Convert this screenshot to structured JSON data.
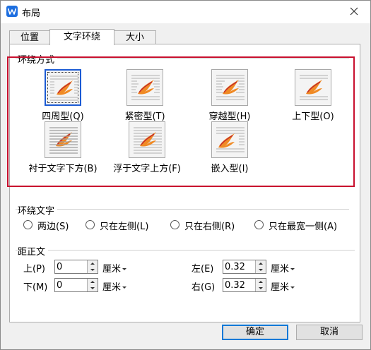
{
  "window": {
    "title": "布局",
    "icon": "wps-w-logo",
    "close_icon": "close-icon"
  },
  "tabs": [
    {
      "label": "位置",
      "active": false
    },
    {
      "label": "文字环绕",
      "active": true
    },
    {
      "label": "大小",
      "active": false
    }
  ],
  "wrap_style": {
    "group_label": "环绕方式",
    "selected": "四周型(Q)",
    "items": [
      {
        "label": "四周型(Q)",
        "icon": "wrap-square-icon"
      },
      {
        "label": "紧密型(T)",
        "icon": "wrap-tight-icon"
      },
      {
        "label": "穿越型(H)",
        "icon": "wrap-through-icon"
      },
      {
        "label": "上下型(O)",
        "icon": "wrap-top-bottom-icon"
      },
      {
        "label": "衬于文字下方(B)",
        "icon": "wrap-behind-text-icon"
      },
      {
        "label": "浮于文字上方(F)",
        "icon": "wrap-in-front-icon"
      },
      {
        "label": "嵌入型(I)",
        "icon": "wrap-inline-icon"
      }
    ]
  },
  "wrap_text": {
    "group_label": "环绕文字",
    "options": [
      "两边(S)",
      "只在左侧(L)",
      "只在右侧(R)",
      "只在最宽一侧(A)"
    ]
  },
  "distance": {
    "group_label": "距正文",
    "top": {
      "label": "上(P)",
      "value": "0",
      "unit": "厘米"
    },
    "bottom": {
      "label": "下(M)",
      "value": "0",
      "unit": "厘米"
    },
    "left": {
      "label": "左(E)",
      "value": "0.32",
      "unit": "厘米"
    },
    "right": {
      "label": "右(G)",
      "value": "0.32",
      "unit": "厘米"
    }
  },
  "buttons": {
    "ok": "确定",
    "cancel": "取消"
  },
  "colors": {
    "highlight_box": "#c8102e",
    "accent": "#0078d7",
    "logo": "#1e6fe0"
  }
}
